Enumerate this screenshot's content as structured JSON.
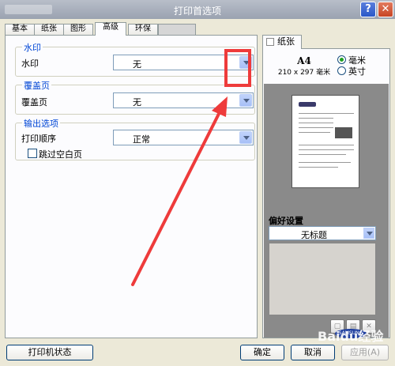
{
  "window": {
    "title": "打印首选项",
    "help_glyph": "?",
    "close_glyph": "✕"
  },
  "tabs": [
    {
      "label": "基本"
    },
    {
      "label": "纸张"
    },
    {
      "label": "图形"
    },
    {
      "label": "高级"
    },
    {
      "label": "环保"
    }
  ],
  "advanced": {
    "watermark_group": "水印",
    "watermark_label": "水印",
    "watermark_value": "无",
    "overlay_group": "覆盖页",
    "overlay_label": "覆盖页",
    "overlay_value": "无",
    "output_group": "输出选项",
    "print_order_label": "打印顺序",
    "print_order_value": "正常",
    "skip_blank_label": "跳过空白页",
    "skip_blank_checked": false
  },
  "preview": {
    "tab_label": "纸张",
    "paper_name": "A4",
    "paper_dims": "210 x 297 毫米",
    "unit_mm": "毫米",
    "unit_inch": "英寸",
    "selected_unit": "mm"
  },
  "preferences": {
    "title": "偏好设置",
    "value": "无标题",
    "brand": "SAMSUNG"
  },
  "buttons": {
    "printer_status": "打印机状态",
    "ok": "确定",
    "cancel": "取消",
    "apply": "应用(A)"
  },
  "annotation": {
    "color": "#ee3b3b"
  },
  "watermark_text": "Baidu经验"
}
